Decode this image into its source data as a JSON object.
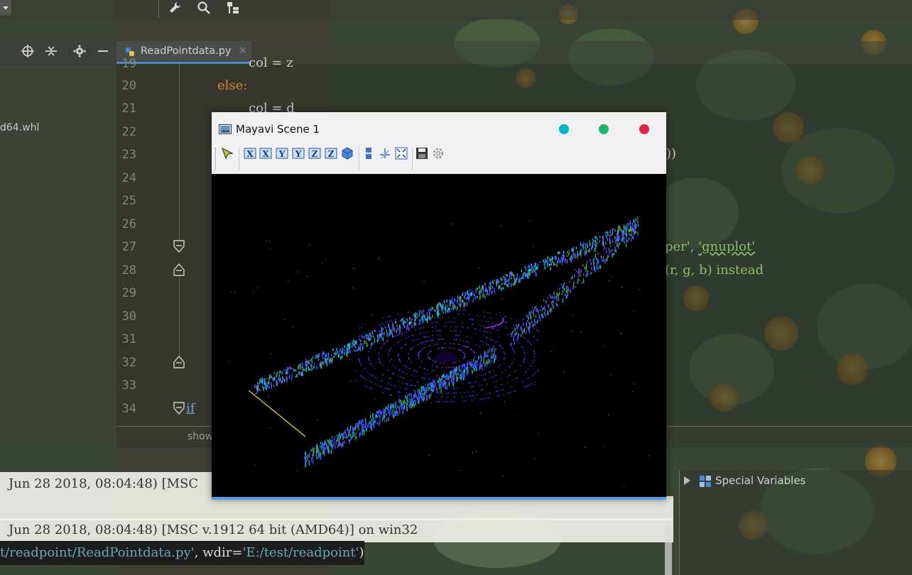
{
  "toolbar": {
    "icons": [
      "wrench-icon",
      "search-icon",
      "structure-icon"
    ]
  },
  "project_panel": {
    "file_label": "d64.whl",
    "icons": [
      "locate-icon",
      "collapse-icon",
      "gear-icon",
      "hide-icon"
    ]
  },
  "editor": {
    "tab_label": "ReadPointdata.py",
    "tab_close": "×",
    "line_numbers": [
      "19",
      "20",
      "21",
      "22",
      "23",
      "24",
      "25",
      "26",
      "27",
      "28",
      "29",
      "30",
      "31",
      "32",
      "33",
      "34"
    ],
    "code": {
      "line19": "col = z",
      "line20": "else:",
      "line21": "col = d",
      "line23_tail": "))",
      "line27_tail_a": "per', ",
      "line27_tail_b": "'gnuplot'",
      "line28_tail": "(r, g, b) instead",
      "line34": "if"
    },
    "bottom_label": "show"
  },
  "console": {
    "line1": "Jun 28 2018, 08:04:48) [MSC",
    "line2": "Jun 28 2018, 08:04:48) [MSC v.1912 64 bit (AMD64)] on win32",
    "line3_path": "t/readpoint/ReadPointdata.py'",
    "line3_mid": ", wdir=",
    "line3_wdir": "'E:/test/readpoint'",
    "line3_end": ")"
  },
  "variables_panel": {
    "label": "Special Variables"
  },
  "mayavi": {
    "title": "Mayavi Scene 1",
    "buttons": {
      "minimize_color": "#00b5c8",
      "maximize_color": "#1fb36a",
      "close_color": "#e0234e"
    },
    "tools": [
      "pick-icon",
      "view-x-plus-icon",
      "view-x-minus-icon",
      "view-y-plus-icon",
      "view-y-minus-icon",
      "view-z-plus-icon",
      "view-z-minus-icon",
      "isometric-icon",
      "parallel-projection-icon",
      "axes-icon",
      "fullscreen-icon",
      "save-icon",
      "settings-icon"
    ]
  }
}
